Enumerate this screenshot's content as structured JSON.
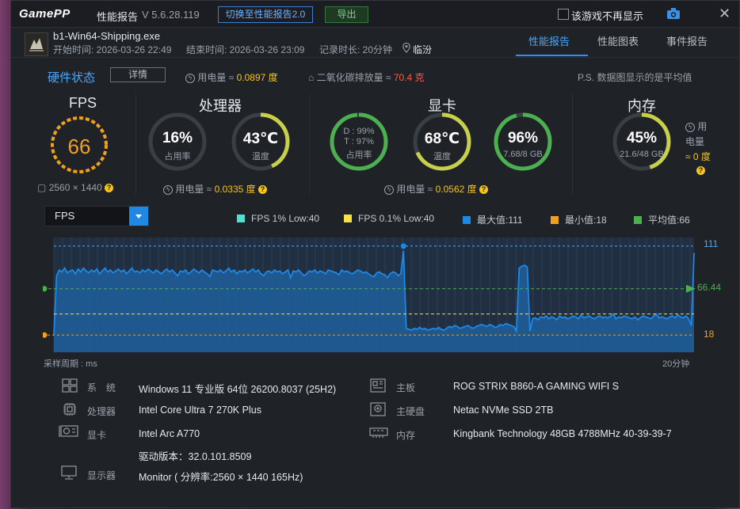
{
  "app": {
    "logo": "GamePP",
    "title": "性能报告",
    "version": "V 5.6.28.119",
    "switch_label": "切换至性能报告2.0",
    "export_label": "导出",
    "dont_show_label": "该游戏不再显示",
    "icons": {
      "camera": "camera-icon",
      "close": "close-icon"
    }
  },
  "session": {
    "process": "b1-Win64-Shipping.exe",
    "start": "开始时间: 2026-03-26 22:49",
    "end": "结束时间: 2026-03-26 23:09",
    "duration": "记录时长: 20分钟",
    "location": "临汾"
  },
  "tabs": [
    "性能报告",
    "性能图表",
    "事件报告"
  ],
  "hardware": {
    "title": "硬件状态",
    "detail_label": "详情",
    "power_label": "用电量 ≈",
    "power_value": "0.0897 度",
    "co2_label": "二氧化碳排放量 ≈",
    "co2_value": "70.4 克",
    "note": "P.S. 数据图显示的是平均值"
  },
  "fps": {
    "title": "FPS",
    "value": "66",
    "resolution": "2560 × 1440"
  },
  "cpu": {
    "title": "处理器",
    "usage": "16%",
    "usage_label": "占用率",
    "temp": "43℃",
    "temp_label": "温度",
    "power_label": "用电量 ≈",
    "power_value": "0.0335 度"
  },
  "gpu": {
    "title": "显卡",
    "d_line": "D : 99%",
    "t_line": "T : 97%",
    "usage_label": "占用率",
    "temp": "68℃",
    "temp_label": "温度",
    "vram": "96%",
    "vram_sub": "7.68/8 GB",
    "power_label": "用电量 ≈",
    "power_value": "0.0562 度"
  },
  "mem": {
    "title": "内存",
    "usage": "45%",
    "sub": "21.6/48 GB",
    "power_label1": "用",
    "power_label2": "电量",
    "power_value": "≈ 0 度"
  },
  "chart_controls": {
    "metric": "FPS",
    "legend": [
      {
        "label": "FPS 1% Low:40",
        "color": "#4fe0d0"
      },
      {
        "label": "FPS 0.1% Low:40",
        "color": "#f5e04a"
      },
      {
        "label": "最大值:111",
        "color": "#1e88e5"
      },
      {
        "label": "最小值:18",
        "color": "#f0a020"
      },
      {
        "label": "平均值:66",
        "color": "#4caf50"
      }
    ],
    "axis_max": "111",
    "axis_avg": "66.44",
    "axis_min": "18",
    "foot_left": "采样周期 : ms",
    "foot_right": "20分钟"
  },
  "chart_data": {
    "type": "area",
    "series": [
      {
        "name": "FPS",
        "values": [
          18,
          80,
          86,
          84,
          88,
          83,
          85,
          86,
          82,
          87,
          84,
          88,
          85,
          83,
          86,
          84,
          87,
          82,
          85,
          88,
          84,
          86,
          83,
          85,
          87,
          84,
          86,
          82,
          85,
          88,
          84,
          85,
          83,
          86,
          84,
          87,
          85,
          83,
          86,
          84,
          82,
          85,
          87,
          84,
          86,
          83,
          80,
          85,
          84,
          86,
          82,
          84,
          87,
          85,
          83,
          86,
          84,
          82,
          79,
          86,
          85,
          84,
          86,
          83,
          85,
          88,
          84,
          86,
          82,
          85,
          84,
          86,
          83,
          85,
          87,
          84,
          86,
          82,
          80,
          84,
          85,
          83,
          86,
          84,
          85,
          82,
          84,
          86,
          78,
          85,
          84,
          86,
          83,
          80,
          82,
          85,
          84,
          86,
          83,
          85,
          84,
          82,
          86,
          85,
          84,
          83,
          81,
          86,
          84,
          85,
          83,
          82,
          84,
          86,
          85,
          83,
          84,
          82,
          80,
          79,
          83,
          84,
          82,
          81,
          78,
          82,
          84,
          83,
          80,
          82,
          106,
          25,
          24,
          23,
          25,
          24,
          26,
          24,
          25,
          23,
          24,
          25,
          24,
          26,
          24,
          23,
          25,
          27,
          26,
          28,
          27,
          25,
          26,
          27,
          28,
          26,
          25,
          27,
          28,
          29,
          28,
          27,
          29,
          28,
          26,
          27,
          29,
          28,
          30,
          29,
          28,
          27,
          22,
          88,
          90,
          91,
          89,
          22,
          35,
          36,
          34,
          37,
          36,
          38,
          35,
          37,
          36,
          34,
          38,
          36,
          37,
          35,
          36,
          38,
          37,
          35,
          39,
          36,
          37,
          38,
          36,
          35,
          37,
          38,
          36,
          37,
          36,
          38,
          40,
          35,
          37,
          36,
          38,
          37,
          36,
          35,
          37,
          34,
          36,
          38,
          37,
          36,
          35,
          38,
          40,
          36,
          37,
          36,
          35,
          37,
          38,
          36,
          39,
          37,
          36,
          38,
          35,
          28,
          104
        ]
      }
    ],
    "ymin": 0,
    "ymax": 120,
    "reference_lines": {
      "max": 111,
      "avg": 66.44,
      "min": 18
    },
    "x_end_label": "20分钟"
  },
  "system": {
    "os_label": "系　统",
    "os": "Windows 11 专业版 64位 26200.8037 (25H2)",
    "cpu_label": "处理器",
    "cpu": "Intel Core Ultra 7 270K Plus",
    "gpu_label": "显卡",
    "gpu": "Intel Arc A770",
    "driver": "驱动版本：32.0.101.8509",
    "monitor_label": "显示器",
    "monitor": "Monitor ( 分辨率:2560 × 1440 165Hz)",
    "mb_label": "主板",
    "mb": "ROG STRIX B860-A GAMING WIFI S",
    "disk_label": "主硬盘",
    "disk": "Netac NVMe SSD 2TB",
    "ram_label": "内存",
    "ram": "Kingbank Technology 48GB 4788MHz 40-39-39-7"
  }
}
